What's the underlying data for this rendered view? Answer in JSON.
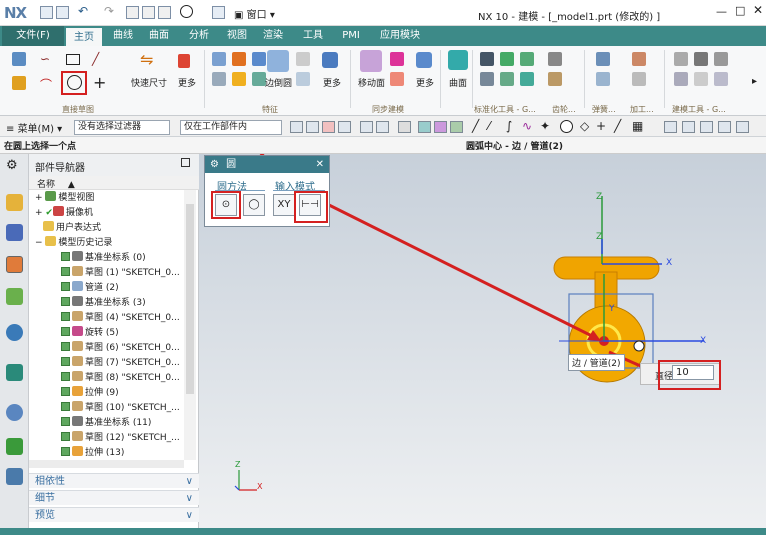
{
  "window": {
    "logo": "NX",
    "title": "NX 10 - 建模 - [_model1.prt  (修改的) ]",
    "window_menu": "窗口"
  },
  "ribbon": {
    "tabs": [
      "文件(F)",
      "主页",
      "曲线",
      "曲面",
      "分析",
      "视图",
      "渲染",
      "工具",
      "PMI",
      "应用模块"
    ],
    "buttons": [
      "快速尺寸",
      "更多",
      "边倒圆",
      "更多",
      "移动面",
      "更多",
      "曲面"
    ],
    "groups": [
      "直接草图",
      "特征",
      "同步建模",
      "标准化工具 - G...",
      "齿轮...",
      "弹簧...",
      "加工...",
      "建模工具 - G..."
    ]
  },
  "selection_bar": {
    "menu": "菜单(M)",
    "filter": "没有选择过滤器",
    "scope": "仅在工作部件内"
  },
  "prompt": {
    "left": "在圆上选择一个点",
    "center": "圆弧中心 - 边 / 管道(2)"
  },
  "navigator": {
    "title": "部件导航器",
    "column": "名称",
    "rows": [
      "模型视图",
      "摄像机",
      "用户表达式",
      "模型历史记录",
      "基准坐标系 (0)",
      "草图 (1) \"SKETCH_0...",
      "管道 (2)",
      "基准坐标系 (3)",
      "草图 (4) \"SKETCH_0...",
      "旋转 (5)",
      "草图 (6) \"SKETCH_0...",
      "草图 (7) \"SKETCH_0...",
      "草图 (8) \"SKETCH_0...",
      "拉伸 (9)",
      "草图 (10) \"SKETCH_...",
      "基准坐标系 (11)",
      "草图 (12) \"SKETCH_...",
      "拉伸 (13)"
    ],
    "panels": [
      "相依性",
      "细节",
      "预览"
    ]
  },
  "dialog": {
    "title": "圆",
    "tab1": "圆方法",
    "tab2": "输入模式",
    "btn_xy": "XY"
  },
  "viewport": {
    "tooltip": "边 / 管道(2)",
    "diameter_label": "直径",
    "diameter_value": "10",
    "axes": {
      "z": "Z",
      "x": "X",
      "y": "Y"
    }
  },
  "colors": {
    "accent": "#3d8a88",
    "highlight_red": "#d42020",
    "part_orange": "#f0a400"
  }
}
